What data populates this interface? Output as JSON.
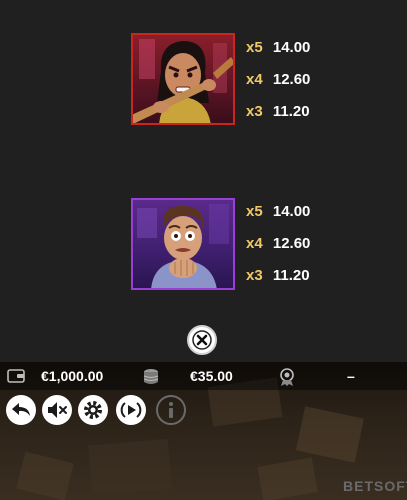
{
  "paytable": {
    "symbols": [
      {
        "name": "angry-woman-symbol",
        "payouts": [
          {
            "multiplier": "x5",
            "amount": "14.00"
          },
          {
            "multiplier": "x4",
            "amount": "12.60"
          },
          {
            "multiplier": "x3",
            "amount": "11.20"
          }
        ]
      },
      {
        "name": "scared-man-symbol",
        "payouts": [
          {
            "multiplier": "x5",
            "amount": "14.00"
          },
          {
            "multiplier": "x4",
            "amount": "12.60"
          },
          {
            "multiplier": "x3",
            "amount": "11.20"
          }
        ]
      }
    ]
  },
  "close_icon": "close-icon",
  "hud": {
    "balance": "€1,000.00",
    "bet": "€35.00",
    "win": "–",
    "icons": [
      "wallet-icon",
      "coins-icon",
      "trophy-icon"
    ]
  },
  "controls": {
    "icons": [
      "back-icon",
      "sound-muted-icon",
      "settings-icon",
      "autoplay-icon",
      "info-icon"
    ]
  },
  "brand": {
    "label": "BETSOFT"
  },
  "colors": {
    "multiplier": "#f0c868",
    "angry_card_border": "#c8261e",
    "scared_card_border": "#9a3ed8",
    "background": "#202020"
  }
}
